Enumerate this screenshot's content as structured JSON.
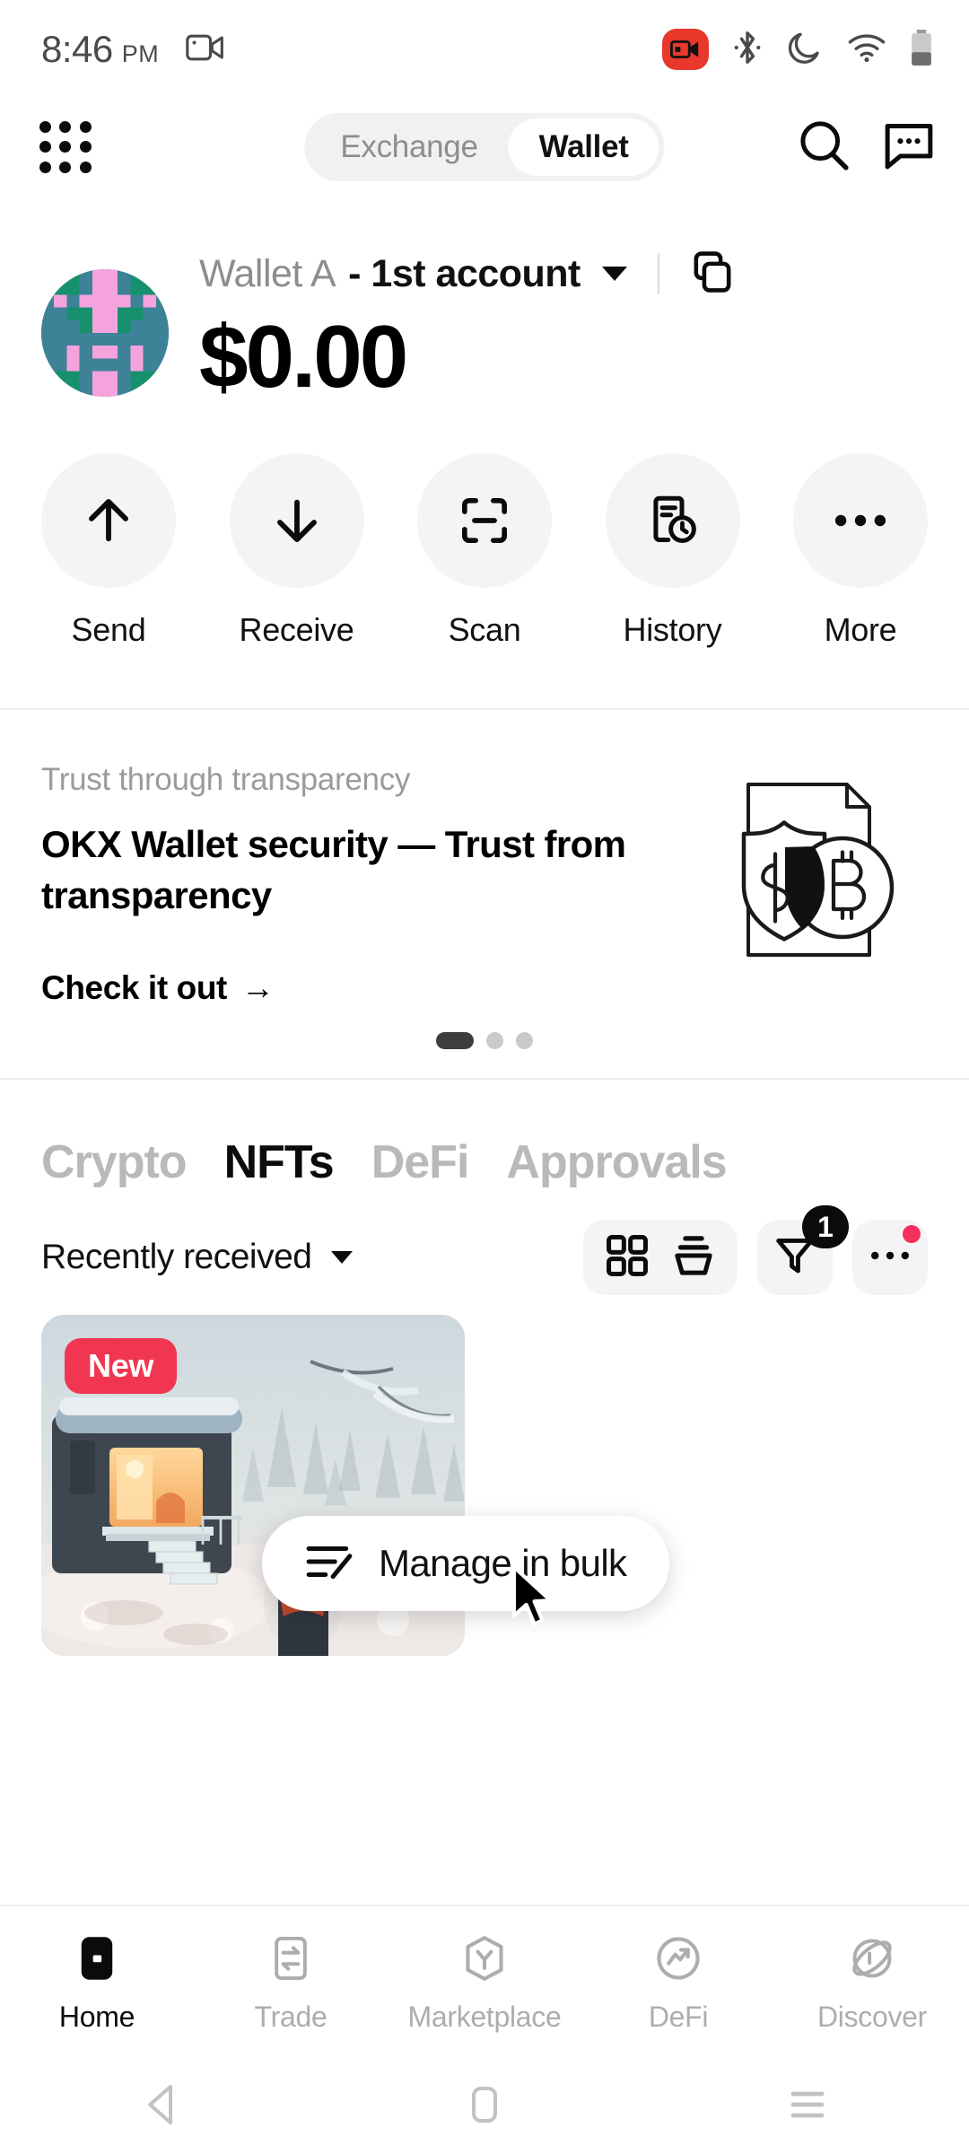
{
  "status_bar": {
    "time": "8:46",
    "ampm": "PM",
    "icons": [
      "screen-record-icon",
      "bluetooth-icon",
      "do-not-disturb-moon-icon",
      "wifi-icon",
      "battery-icon"
    ],
    "record_color": "#e8372b"
  },
  "top_nav": {
    "grid_menu": "grid-menu-icon",
    "segments": [
      {
        "label": "Exchange",
        "active": false
      },
      {
        "label": "Wallet",
        "active": true
      }
    ],
    "search": "search-icon",
    "chat": "chat-icon"
  },
  "account": {
    "wallet_name": "Wallet A",
    "account_name": "- 1st account",
    "balance": "$0.00",
    "copy_icon": "copy-icon",
    "dropdown_icon": "chevron-down-icon",
    "avatar_colors": [
      "#3d8296",
      "#17916d",
      "#f5a3dd"
    ]
  },
  "actions": [
    {
      "label": "Send",
      "icon": "arrow-up-icon"
    },
    {
      "label": "Receive",
      "icon": "arrow-down-icon"
    },
    {
      "label": "Scan",
      "icon": "scan-icon"
    },
    {
      "label": "History",
      "icon": "history-icon"
    },
    {
      "label": "More",
      "icon": "ellipsis-icon"
    }
  ],
  "promo": {
    "kicker": "Trust through transparency",
    "title": "OKX Wallet security — Trust from transparency",
    "cta": "Check it out",
    "cta_arrow": "→",
    "illustration": "shield-document-bitcoin-icon",
    "carousel": {
      "total": 3,
      "active_index": 0
    }
  },
  "tabs": [
    {
      "label": "Crypto",
      "active": false
    },
    {
      "label": "NFTs",
      "active": true
    },
    {
      "label": "DeFi",
      "active": false
    },
    {
      "label": "Approvals",
      "active": false
    }
  ],
  "nft_controls": {
    "sort_label": "Recently received",
    "sort_caret": "chevron-down-icon",
    "view_grid_icon": "grid-view-icon",
    "view_collection_icon": "collection-view-icon",
    "filter_icon": "funnel-filter-icon",
    "filter_badge": "1",
    "more_icon": "ellipsis-icon",
    "more_dot_color": "#f5305c"
  },
  "nft_card": {
    "badge": "New",
    "badge_color": "#f03650",
    "artwork": "winter-cabin-snow-scene"
  },
  "bulk_button": {
    "label": "Manage in bulk",
    "icon": "edit-list-icon"
  },
  "bottom_nav": [
    {
      "label": "Home",
      "icon": "home-icon",
      "active": true
    },
    {
      "label": "Trade",
      "icon": "trade-swap-icon",
      "active": false
    },
    {
      "label": "Marketplace",
      "icon": "marketplace-icon",
      "active": false
    },
    {
      "label": "DeFi",
      "icon": "defi-trend-icon",
      "active": false
    },
    {
      "label": "Discover",
      "icon": "discover-planet-icon",
      "active": false
    }
  ],
  "system_nav": [
    {
      "icon": "back-triangle-icon"
    },
    {
      "icon": "home-square-icon"
    },
    {
      "icon": "recents-menu-icon"
    }
  ]
}
